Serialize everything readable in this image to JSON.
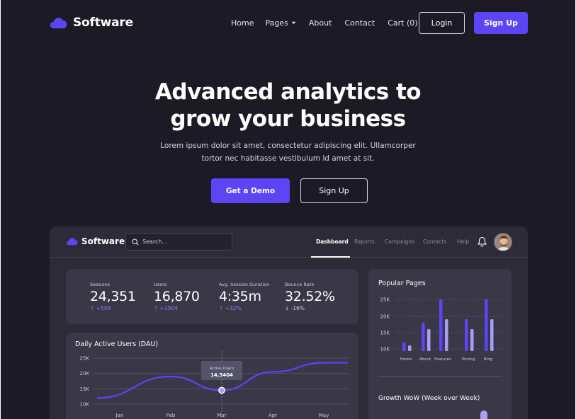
{
  "nav": {
    "brand": "Software",
    "menu": [
      {
        "label": "Home"
      },
      {
        "label": "Pages"
      },
      {
        "label": "About"
      },
      {
        "label": "Contact"
      },
      {
        "label": "Cart (0)"
      }
    ],
    "login_label": "Login",
    "signup_label": "Sign Up"
  },
  "hero": {
    "title_line1": "Advanced analytics to",
    "title_line2": "grow your business",
    "sub_line1": "Lorem ipsum dolor sit amet, consectetur adipiscing elit. Ullamcorper",
    "sub_line2": "tortor nec habitasse vestibulum id amet at sit.",
    "demo_label": "Get a Demo",
    "signup_label": "Sign Up"
  },
  "colors": {
    "accent": "#5b45f5",
    "background": "#1c1a25",
    "panel": "#2d2b38",
    "card": "#3a3847",
    "bar_light": "#a99df9"
  },
  "dashboard": {
    "brand": "Software",
    "search_placeholder": "Search...",
    "tabs": [
      {
        "label": "Dashboard",
        "active": true
      },
      {
        "label": "Reports"
      },
      {
        "label": "Campaigns"
      },
      {
        "label": "Contacts"
      },
      {
        "label": "Help"
      }
    ],
    "icons": {
      "bell": "bell-icon",
      "search": "search-icon",
      "brand": "cloud-icon"
    },
    "stats": [
      {
        "label": "Sessions",
        "value": "24,351",
        "change": "↑ +558",
        "direction": "up"
      },
      {
        "label": "Users",
        "value": "16,870",
        "change": "↑ +1504",
        "direction": "up"
      },
      {
        "label": "Avg. Session Duration",
        "value": "4:35m",
        "change": "↑ +32%",
        "direction": "up"
      },
      {
        "label": "Bounce Rate",
        "value": "32.52%",
        "change": "↓ -16%",
        "direction": "down"
      }
    ],
    "dau": {
      "title": "Daily Active Users (DAU)",
      "tooltip_label": "Active Users",
      "tooltip_value": "14,5404"
    },
    "popular": {
      "title": "Popular Pages"
    },
    "growth": {
      "title": "Growth WoW (Week over Week)"
    }
  },
  "chart_data": [
    {
      "type": "line",
      "title": "Daily Active Users (DAU)",
      "x": [
        "Jan",
        "Feb",
        "Mar",
        "Apr",
        "May"
      ],
      "y_ticks": [
        "25K",
        "20K",
        "15K",
        "10K"
      ],
      "ylim": [
        10000,
        25000
      ],
      "series": [
        {
          "values": [
            12000,
            19000,
            14500,
            20500,
            23500
          ]
        }
      ],
      "highlight": {
        "x": "Mar",
        "label": "Active Users",
        "value": "14,5404"
      },
      "grid": true
    },
    {
      "type": "bar",
      "title": "Popular Pages",
      "categories": [
        "Home",
        "About",
        "Features",
        "Pricing",
        "Blog"
      ],
      "y_ticks": [
        "25K",
        "20K",
        "15K",
        "10K"
      ],
      "ylim": [
        8000,
        25000
      ],
      "series": [
        {
          "color": "#5b45f5",
          "values": [
            12000,
            18000,
            25000,
            19000,
            25000
          ]
        },
        {
          "color": "#a99df9",
          "values": [
            10000,
            16000,
            19000,
            16000,
            19000
          ]
        }
      ],
      "grid": true
    }
  ]
}
